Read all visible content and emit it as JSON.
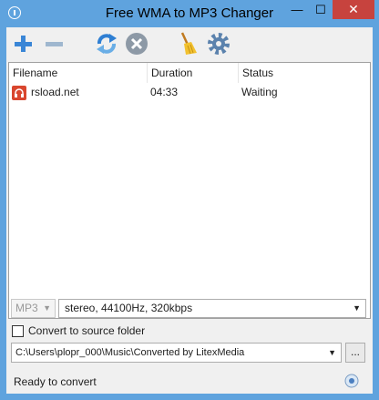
{
  "window": {
    "title": "Free WMA to MP3 Changer",
    "minimize_glyph": "—",
    "maximize_glyph": "☐",
    "close_glyph": "✕"
  },
  "toolbar": {
    "icons": [
      "add-icon",
      "remove-icon",
      "convert-icon",
      "stop-icon",
      "clear-icon",
      "settings-icon"
    ]
  },
  "list": {
    "columns": [
      "Filename",
      "Duration",
      "Status"
    ],
    "rows": [
      {
        "filename": "rsload.net",
        "duration": "04:33",
        "status": "Waiting",
        "icon": "audio-file-icon"
      }
    ]
  },
  "output": {
    "format": "MP3",
    "options": "stereo, 44100Hz, 320kbps",
    "convert_to_source_label": "Convert to source folder",
    "convert_to_source_checked": false,
    "folder": "C:\\Users\\plopr_000\\Music\\Converted by LitexMedia",
    "browse_label": "..."
  },
  "statusbar": {
    "text": "Ready to convert"
  },
  "colors": {
    "titlebar": "#5fa3de",
    "close": "#c7433e",
    "add_remove": "#3a86d6",
    "stop": "#8d99a6"
  }
}
